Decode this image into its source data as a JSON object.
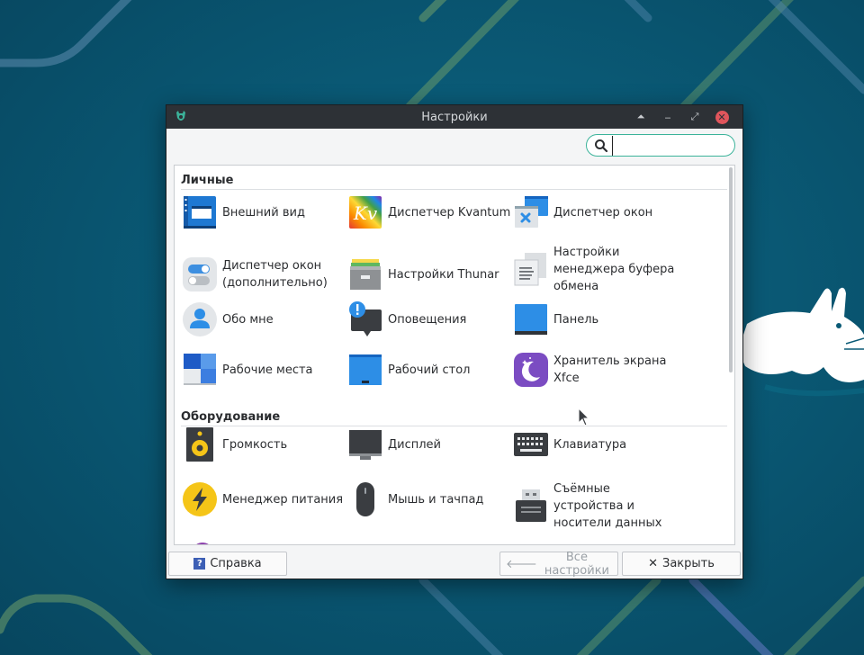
{
  "window": {
    "title": "Настройки",
    "controls": {
      "shade": "⏶",
      "minimize": "‒",
      "maximize": "⤢",
      "close": "✕"
    }
  },
  "search": {
    "value": "",
    "placeholder": ""
  },
  "sections": [
    {
      "title": "Личные",
      "items": [
        {
          "label": "Внешний вид",
          "icon": "appearance-icon"
        },
        {
          "label": "Диспетчер Kvantum",
          "icon": "kvantum-icon"
        },
        {
          "label": "Диспетчер окон",
          "icon": "window-manager-icon"
        },
        {
          "label": "Диспетчер окон (дополнительно)",
          "icon": "window-manager-tweaks-icon"
        },
        {
          "label": "Настройки Thunar",
          "icon": "thunar-icon"
        },
        {
          "label": "Настройки менеджера буфера обмена",
          "icon": "clipboard-icon"
        },
        {
          "label": "Обо мне",
          "icon": "about-me-icon"
        },
        {
          "label": "Оповещения",
          "icon": "notifications-icon"
        },
        {
          "label": "Панель",
          "icon": "panel-icon"
        },
        {
          "label": "Рабочие места",
          "icon": "workspaces-icon"
        },
        {
          "label": "Рабочий стол",
          "icon": "desktop-icon"
        },
        {
          "label": "Хранитель экрана Xfce",
          "icon": "screensaver-icon"
        }
      ]
    },
    {
      "title": "Оборудование",
      "items": [
        {
          "label": "Громкость",
          "icon": "speaker-icon"
        },
        {
          "label": "Дисплей",
          "icon": "display-icon"
        },
        {
          "label": "Клавиатура",
          "icon": "keyboard-icon"
        },
        {
          "label": "Менеджер питания",
          "icon": "power-icon"
        },
        {
          "label": "Мышь и тачпад",
          "icon": "mouse-icon"
        },
        {
          "label": "Съёмные устройства и носители данных",
          "icon": "removable-drive-icon"
        }
      ]
    }
  ],
  "footer": {
    "help_label": "Справка",
    "all_settings_label": "Все настройки",
    "close_label": "Закрыть"
  }
}
